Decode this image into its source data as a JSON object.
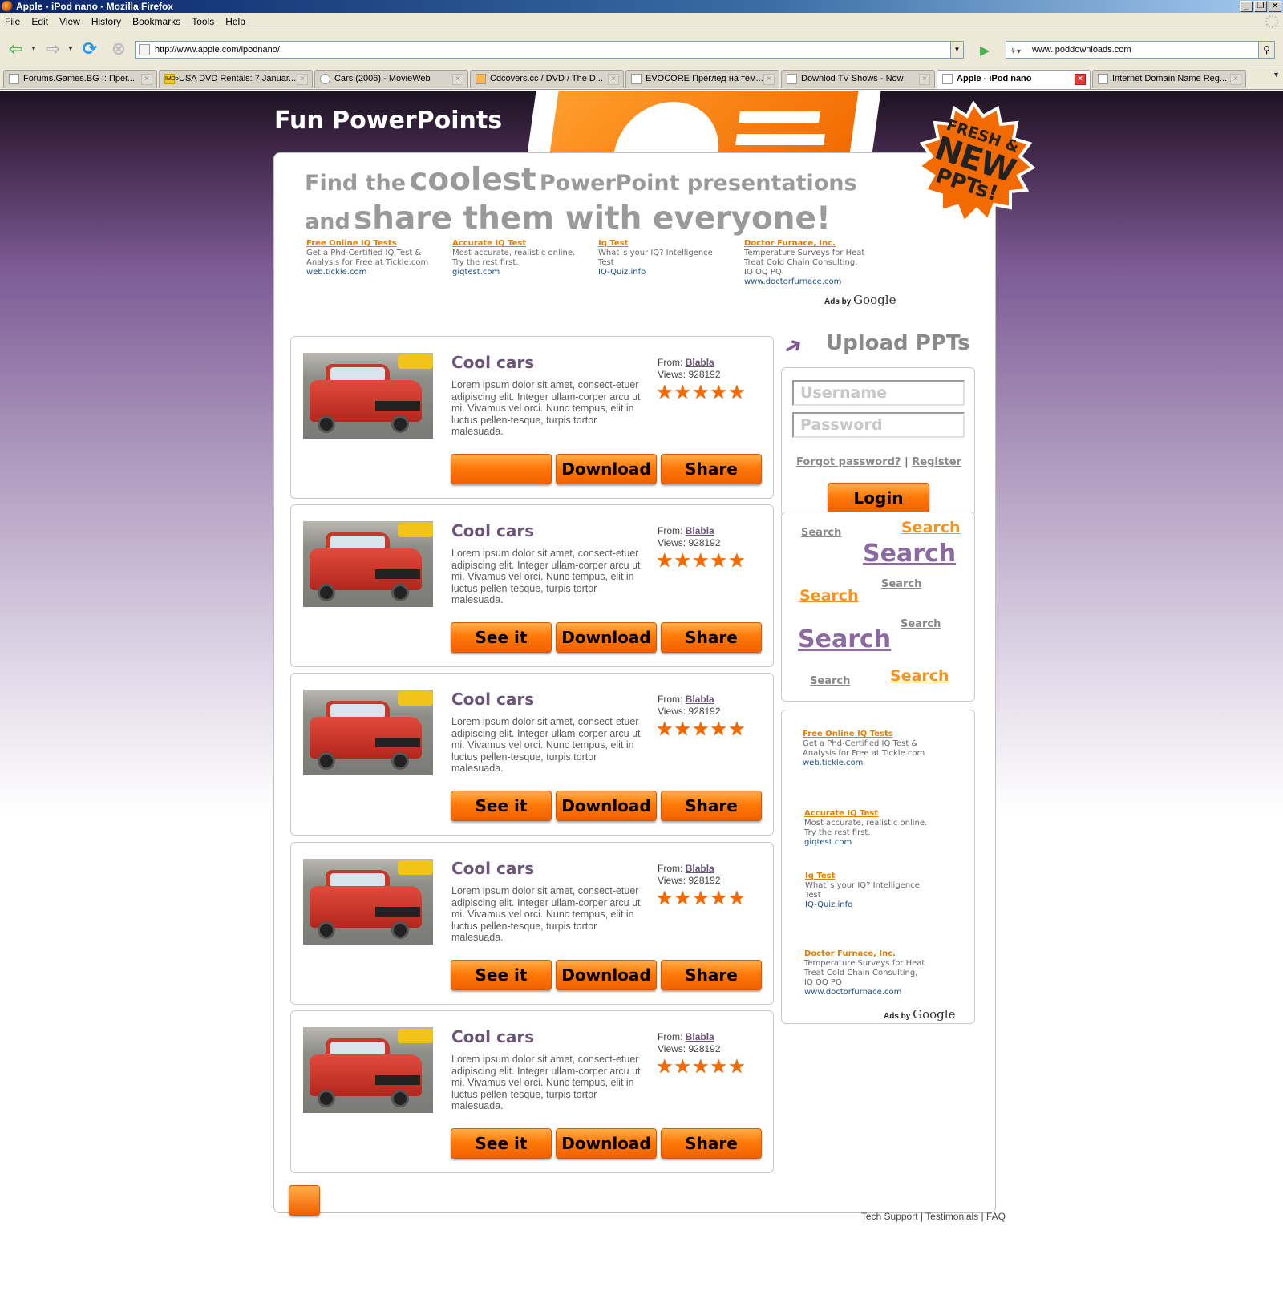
{
  "browser": {
    "window_title": "Apple - iPod nano - Mozilla Firefox",
    "menu": [
      "File",
      "Edit",
      "View",
      "History",
      "Bookmarks",
      "Tools",
      "Help"
    ],
    "url": "http://www.apple.com/ipodnano/",
    "search_value": "www.ipoddownloads.com",
    "tabs": [
      {
        "label": "Forums.Games.BG :: Прег...",
        "icon": "page-icon"
      },
      {
        "label": "USA DVD Rentals: 7 Januar...",
        "icon": "imdb-icon"
      },
      {
        "label": "Cars (2006) - MovieWeb",
        "icon": "movieweb-icon"
      },
      {
        "label": "Cdcovers.cc / DVD / The D...",
        "icon": "cdcovers-icon"
      },
      {
        "label": "EVOCORE Преглед на тем...",
        "icon": "page-icon"
      },
      {
        "label": "Downlod TV Shows - Now",
        "icon": "page-icon"
      },
      {
        "label": "Apple - iPod nano",
        "icon": "apple-icon",
        "active": true
      },
      {
        "label": "Internet Domain Name Reg...",
        "icon": "page-icon"
      }
    ]
  },
  "site": {
    "title": "Fun PowerPoints",
    "badge": {
      "line1": "FRESH &",
      "line2": "NEW",
      "line3": "PPTs!"
    },
    "hero": {
      "w1": "Find the",
      "w2": "coolest",
      "w3": "PowerPoint presentations",
      "w4": "and",
      "w5": "share them with everyone!"
    }
  },
  "ads_top": [
    {
      "head": "Free Online IQ Tests",
      "body1": "Get a Phd-Certified IQ Test &",
      "body2": "Analysis for Free at Tickle.com",
      "body3": "",
      "url": "web.tickle.com"
    },
    {
      "head": "Accurate IQ Test",
      "body1": "Most accurate, realistic online.",
      "body2": "Try the rest first.",
      "body3": "",
      "url": "giqtest.com"
    },
    {
      "head": "Iq Test",
      "body1": "What`s your IQ? Intelligence",
      "body2": "Test",
      "body3": "",
      "url": "IQ-Quiz.info"
    },
    {
      "head": "Doctor Furnace, Inc.",
      "body1": "Temperature Surveys for Heat",
      "body2": "Treat Cold Chain Consulting,",
      "body3": "IQ OQ PQ",
      "url": "www.doctorfurnace.com"
    }
  ],
  "ads_by": {
    "label": "Ads by",
    "brand": "Google"
  },
  "items": [
    {
      "title": "Cool cars",
      "desc": "Lorem ipsum dolor sit amet, consect-etuer adipiscing elit. Integer ullam-corper arcu ut mi. Vivamus vel orci. Nunc tempus, elit in luctus pellen-tesque, turpis tortor malesuada.",
      "from_label": "From:",
      "author": "Blabla",
      "views_label": "Views:",
      "views": "928192",
      "rating": 5,
      "btn1": "",
      "btn2": "Download",
      "btn3": "Share"
    },
    {
      "title": "Cool cars",
      "desc": "Lorem ipsum dolor sit amet, consect-etuer adipiscing elit. Integer ullam-corper arcu ut mi. Vivamus vel orci. Nunc tempus, elit in luctus pellen-tesque, turpis tortor malesuada.",
      "from_label": "From:",
      "author": "Blabla",
      "views_label": "Views:",
      "views": "928192",
      "rating": 5,
      "btn1": "See it",
      "btn2": "Download",
      "btn3": "Share"
    },
    {
      "title": "Cool cars",
      "desc": "Lorem ipsum dolor sit amet, consect-etuer adipiscing elit. Integer ullam-corper arcu ut mi. Vivamus vel orci. Nunc tempus, elit in luctus pellen-tesque, turpis tortor malesuada.",
      "from_label": "From:",
      "author": "Blabla",
      "views_label": "Views:",
      "views": "928192",
      "rating": 5,
      "btn1": "See it",
      "btn2": "Download",
      "btn3": "Share"
    },
    {
      "title": "Cool cars",
      "desc": "Lorem ipsum dolor sit amet, consect-etuer adipiscing elit. Integer ullam-corper arcu ut mi. Vivamus vel orci. Nunc tempus, elit in luctus pellen-tesque, turpis tortor malesuada.",
      "from_label": "From:",
      "author": "Blabla",
      "views_label": "Views:",
      "views": "928192",
      "rating": 5,
      "btn1": "See it",
      "btn2": "Download",
      "btn3": "Share"
    },
    {
      "title": "Cool cars",
      "desc": "Lorem ipsum dolor sit amet, consect-etuer adipiscing elit. Integer ullam-corper arcu ut mi. Vivamus vel orci. Nunc tempus, elit in luctus pellen-tesque, turpis tortor malesuada.",
      "from_label": "From:",
      "author": "Blabla",
      "views_label": "Views:",
      "views": "928192",
      "rating": 5,
      "btn1": "See it",
      "btn2": "Download",
      "btn3": "Share"
    }
  ],
  "sidebar": {
    "upload_title": "Upload PPTs",
    "username_placeholder": "Username",
    "password_placeholder": "Password",
    "forgot": "Forgot password?",
    "sep": "|",
    "register": "Register",
    "login": "Login",
    "search_word": "Search"
  },
  "ads_side": [
    {
      "head": "Free Online IQ Tests",
      "body1": "Get a Phd-Certified IQ Test &",
      "body2": "Analysis for Free at Tickle.com",
      "body3": "",
      "url": "web.tickle.com"
    },
    {
      "head": "Accurate IQ Test",
      "body1": "Most accurate, realistic online.",
      "body2": "Try the rest first.",
      "body3": "",
      "url": "giqtest.com"
    },
    {
      "head": "Iq Test",
      "body1": "What`s your IQ? Intelligence",
      "body2": "Test",
      "body3": "",
      "url": "IQ-Quiz.info"
    },
    {
      "head": "Doctor Furnace, Inc.",
      "body1": "Temperature Surveys for Heat",
      "body2": "Treat Cold Chain Consulting,",
      "body3": "IQ OQ PQ",
      "url": "www.doctorfurnace.com"
    }
  ],
  "footer": {
    "links": [
      "Tech Support",
      "Testimonials",
      "FAQ"
    ],
    "sep": "|"
  },
  "colors": {
    "accent_orange": "#f26a00",
    "brand_purple": "#6b5577",
    "text_gray": "#9a9a9a"
  }
}
